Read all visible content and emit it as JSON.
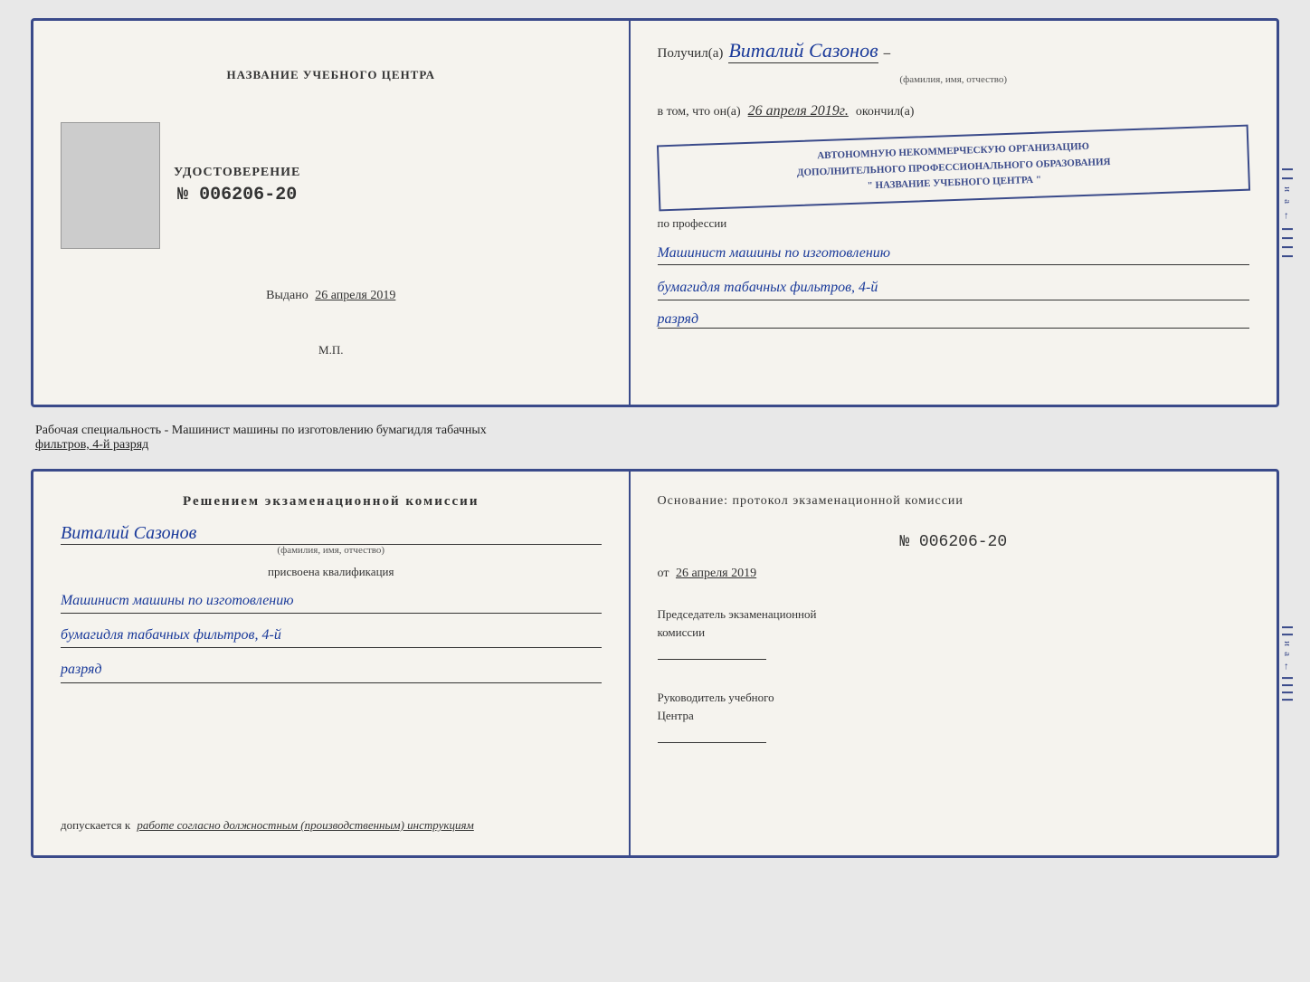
{
  "top_cert": {
    "left": {
      "org_name": "НАЗВАНИЕ УЧЕБНОГО ЦЕНТРА",
      "cert_title": "УДОСТОВЕРЕНИЕ",
      "cert_number": "№ 006206-20",
      "issued_label": "Выдано",
      "issued_date": "26 апреля 2019",
      "signature_label": "М.П."
    },
    "right": {
      "recipient_prefix": "Получил(а)",
      "recipient_name": "Виталий Сазонов",
      "recipient_sub": "(фамилия, имя, отчество)",
      "dash": "–",
      "confirm_prefix": "в том, что он(а)",
      "confirm_date": "26 апреля 2019г.",
      "finished_label": "окончил(а)",
      "stamp_line1": "АВТОНОМНУЮ НЕКОММЕРЧЕСКУЮ ОРГАНИЗАЦИЮ",
      "stamp_line2": "ДОПОЛНИТЕЛЬНОГО ПРОФЕССИОНАЛЬНОГО ОБРАЗОВАНИЯ",
      "stamp_line3": "\" НАЗВАНИЕ УЧЕБНОГО ЦЕНТРА \"",
      "profession_label": "по профессии",
      "profession_line1": "Машинист машины по изготовлению",
      "profession_line2": "бумагидля табачных фильтров, 4-й",
      "rank": "разряд"
    }
  },
  "below_text": {
    "main": "Рабочая специальность - Машинист машины по изготовлению бумагидля табачных",
    "underline": "фильтров, 4-й разряд"
  },
  "bottom_cert": {
    "left": {
      "decision_title": "Решением  экзаменационной  комиссии",
      "person_name": "Виталий Сазонов",
      "person_sub": "(фамилия, имя, отчество)",
      "qualification_label": "присвоена квалификация",
      "qual_line1": "Машинист машины по изготовлению",
      "qual_line2": "бумагидля табачных фильтров, 4-й",
      "qual_line3": "разряд",
      "admission_prefix": "допускается к",
      "admission_text": "работе согласно должностным (производственным) инструкциям"
    },
    "right": {
      "basis_label": "Основание: протокол экзаменационной  комиссии",
      "protocol_number": "№  006206-20",
      "date_prefix": "от",
      "date_value": "26 апреля 2019",
      "chairman_title": "Председатель экзаменационной",
      "chairman_title2": "комиссии",
      "director_title": "Руководитель учебного",
      "director_title2": "Центра"
    }
  }
}
